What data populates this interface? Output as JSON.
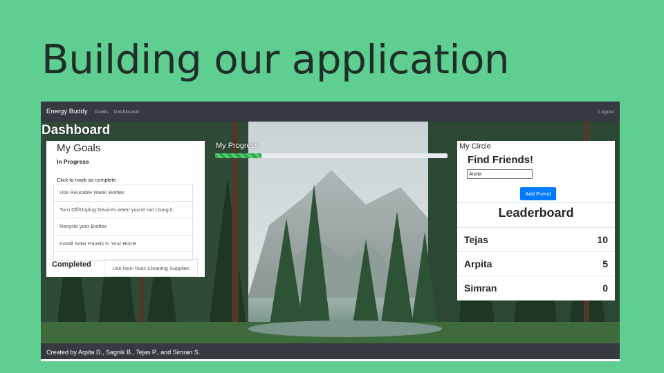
{
  "slide": {
    "title": "Building our application"
  },
  "navbar": {
    "brand": "Energy Buddy",
    "links": [
      "Goals",
      "Dashboard"
    ],
    "logout": "Logout"
  },
  "dashboard": {
    "title": "Dashboard"
  },
  "goals": {
    "title": "My Goals",
    "subtitle": "In Progress",
    "hint": "Click to mark as complete",
    "in_progress": [
      "Use Reusable Water Bottles",
      "Turn Off/Unplug Devices when you're not Using it",
      "Recycle your Bottles",
      "Install Solar Panels in Your Home"
    ],
    "completed_label": "Completed",
    "completed": [
      "Use Non-Toxic Cleaning Supplies"
    ]
  },
  "progress": {
    "label": "My Progress",
    "percent": 20
  },
  "circle": {
    "label": "My Circle",
    "find_title": "Find Friends!",
    "input_value": "Arpita",
    "add_button": "Add Friend",
    "leaderboard_title": "Leaderboard",
    "leaderboard": [
      {
        "name": "Tejas",
        "score": "10"
      },
      {
        "name": "Arpita",
        "score": "5"
      },
      {
        "name": "Simran",
        "score": "0"
      }
    ]
  },
  "footer": {
    "text": "Created by Arpita D., Sagnik B., Tejas P., and Simran S."
  },
  "colors": {
    "slide_bg": "#5fce91",
    "navbar_bg": "#343a40",
    "primary": "#007bff",
    "progress": "#28a745"
  }
}
